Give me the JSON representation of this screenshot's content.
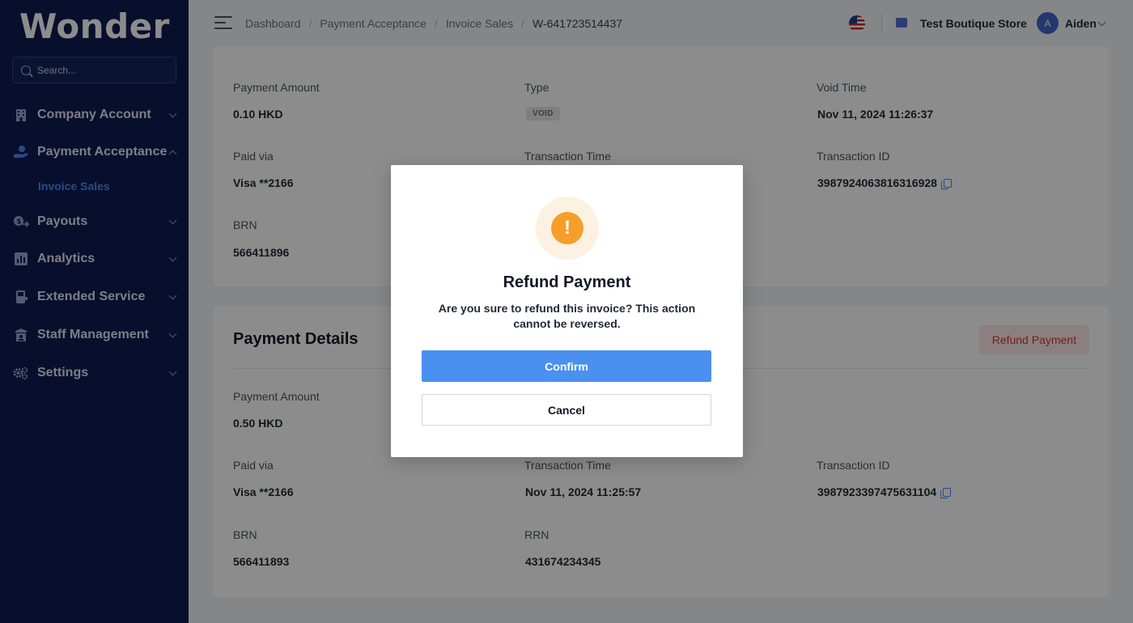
{
  "brand": {
    "logo": "Wonder"
  },
  "search": {
    "placeholder": "Search..."
  },
  "sidebar": {
    "items": [
      {
        "label": "Company Account",
        "icon": "building-icon"
      },
      {
        "label": "Payment Acceptance",
        "icon": "hand-coin-icon",
        "expanded": true
      },
      {
        "label": "Payouts",
        "icon": "dollar-transfer-icon"
      },
      {
        "label": "Analytics",
        "icon": "bar-chart-icon"
      },
      {
        "label": "Extended Service",
        "icon": "pos-terminal-icon"
      },
      {
        "label": "Staff Management",
        "icon": "staff-icon"
      },
      {
        "label": "Settings",
        "icon": "gears-icon"
      }
    ],
    "sub_item": "Invoice Sales"
  },
  "header": {
    "breadcrumb": [
      "Dashboard",
      "Payment Acceptance",
      "Invoice Sales",
      "W-641723514437"
    ],
    "store": "Test Boutique Store",
    "avatar_initial": "A",
    "user": "Aiden"
  },
  "void_card": {
    "payment_amount_label": "Payment Amount",
    "payment_amount": "0.10 HKD",
    "type_label": "Type",
    "type": "VOID",
    "void_time_label": "Void Time",
    "void_time": "Nov 11, 2024 11:26:37",
    "paid_via_label": "Paid via",
    "paid_via": "Visa **2166",
    "transaction_time_label": "Transaction Time",
    "transaction_id_label": "Transaction ID",
    "transaction_id": "3987924063816316928",
    "brn_label": "BRN",
    "brn": "566411896"
  },
  "details_card": {
    "title": "Payment Details",
    "refund_button": "Refund Payment",
    "payment_amount_label": "Payment Amount",
    "payment_amount": "0.50 HKD",
    "paid_via_label": "Paid via",
    "paid_via": "Visa **2166",
    "transaction_time_label": "Transaction Time",
    "transaction_time": "Nov 11, 2024 11:25:57",
    "transaction_id_label": "Transaction ID",
    "transaction_id": "3987923397475631104",
    "brn_label": "BRN",
    "brn": "566411893",
    "rrn_label": "RRN",
    "rrn": "431674234345"
  },
  "modal": {
    "icon": "exclamation",
    "title": "Refund Payment",
    "message": "Are you sure to refund this invoice? This action cannot be reversed.",
    "confirm": "Confirm",
    "cancel": "Cancel"
  },
  "colors": {
    "sidebar_bg": "#0f1d52",
    "primary": "#4a90f0",
    "warning": "#f59e2a",
    "danger": "#d23a3a"
  }
}
